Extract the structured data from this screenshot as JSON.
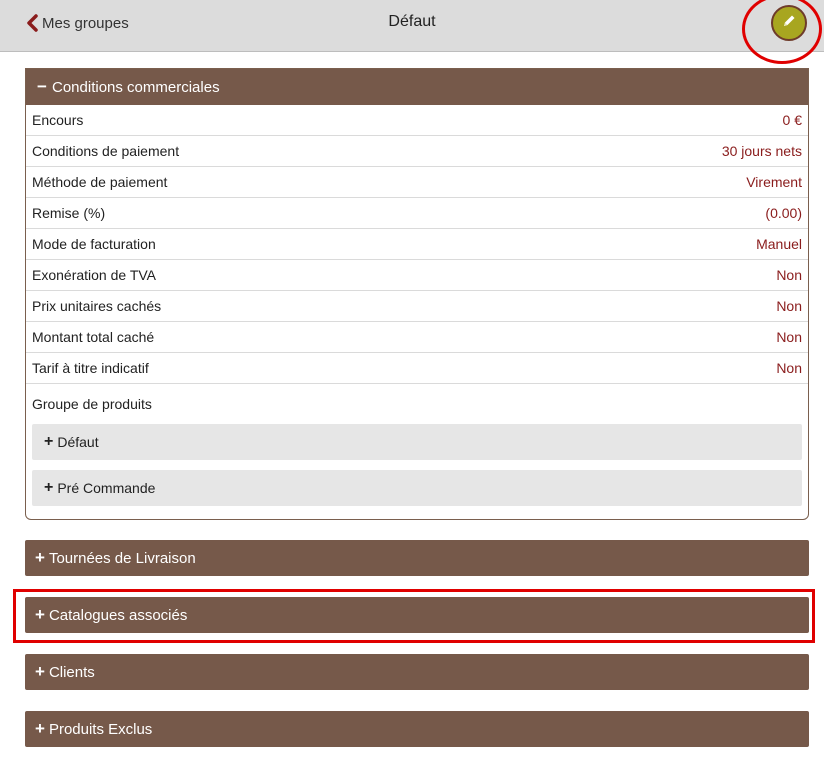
{
  "header": {
    "back_label": "Mes groupes",
    "title": "Défaut"
  },
  "conditions": {
    "title": "Conditions commerciales",
    "rows": [
      {
        "label": "Encours",
        "value": "0 €"
      },
      {
        "label": "Conditions de paiement",
        "value": "30 jours nets"
      },
      {
        "label": "Méthode de paiement",
        "value": "Virement"
      },
      {
        "label": "Remise (%)",
        "value": "(0.00)"
      },
      {
        "label": "Mode de facturation",
        "value": "Manuel"
      },
      {
        "label": "Exonération de TVA",
        "value": "Non"
      },
      {
        "label": "Prix unitaires cachés",
        "value": "Non"
      },
      {
        "label": "Montant total caché",
        "value": "Non"
      },
      {
        "label": "Tarif à titre indicatif",
        "value": "Non"
      }
    ],
    "group_label": "Groupe de produits",
    "groups": [
      "Défaut",
      "Pré Commande"
    ]
  },
  "sections": [
    "Tournées de Livraison",
    "Catalogues associés",
    "Clients",
    "Produits Exclus"
  ],
  "colors": {
    "panel": "#76594a",
    "value": "#8a1c1c",
    "edit_button": "#a8a620",
    "highlight": "#e00000"
  },
  "icons": {
    "back": "chevron-left-icon",
    "edit": "pencil-icon",
    "expand": "plus-icon",
    "collapse": "minus-icon"
  }
}
